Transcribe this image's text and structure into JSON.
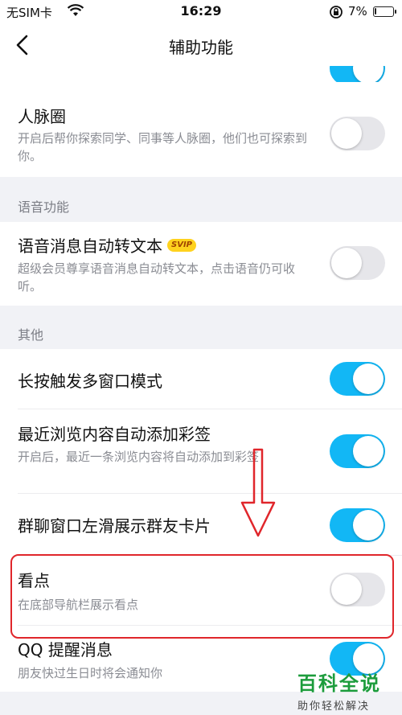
{
  "status": {
    "carrier": "无SIM卡",
    "time": "16:29",
    "battery": "7%",
    "battery_level": 0.07
  },
  "nav": {
    "title": "辅助功能"
  },
  "rows": {
    "contacts_circle": {
      "title": "人脉圈",
      "desc": "开启后帮你探索同学、同事等人脉圈，他们也可探索到你。",
      "enabled": false
    },
    "voice_to_text": {
      "title": "语音消息自动转文本",
      "badge": "SVIP",
      "desc": "超级会员尊享语音消息自动转文本，点击语音仍可收听。",
      "enabled": false
    },
    "multi_window": {
      "title": "长按触发多窗口模式",
      "enabled": true
    },
    "auto_tag": {
      "title": "最近浏览内容自动添加彩签",
      "desc": "开启后，最近一条浏览内容将自动添加到彩签",
      "enabled": true
    },
    "group_swipe": {
      "title": "群聊窗口左滑展示群友卡片",
      "enabled": true
    },
    "kandian": {
      "title": "看点",
      "desc": "在底部导航栏展示看点",
      "enabled": false
    },
    "qq_remind": {
      "title": "QQ 提醒消息",
      "desc": "朋友快过生日时将会通知你",
      "enabled": true
    }
  },
  "sections": {
    "voice": "语音功能",
    "other": "其他"
  },
  "colors": {
    "toggle_on": "#12b7f5",
    "toggle_off": "#e6e6ea",
    "annotation": "#e0262b",
    "watermark": "#1c9c3c"
  },
  "watermark": {
    "main": "百科全说",
    "sub": "助你轻松解决"
  }
}
